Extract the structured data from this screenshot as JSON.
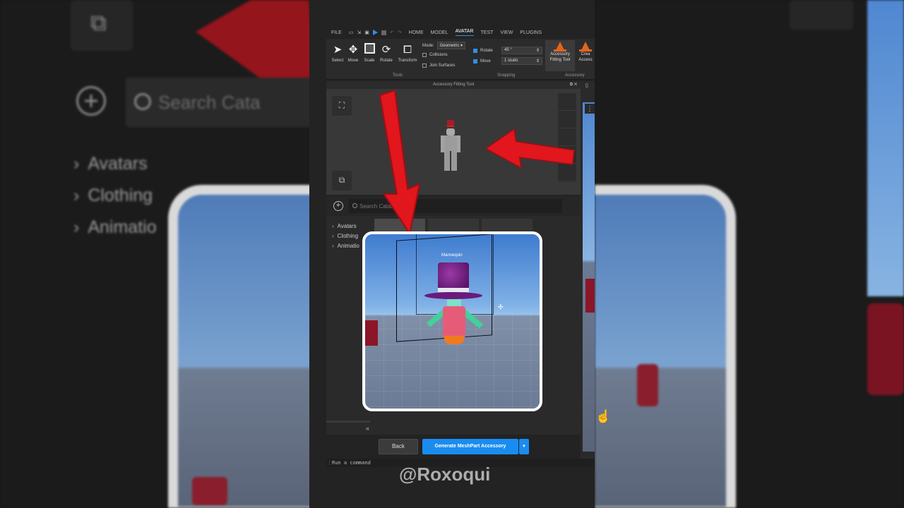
{
  "menu": {
    "file": "FILE",
    "tabs": [
      "HOME",
      "MODEL",
      "AVATAR",
      "TEST",
      "VIEW",
      "PLUGINS"
    ],
    "active_tab": "AVATAR"
  },
  "ribbon": {
    "tools": [
      "Select",
      "Move",
      "Scale",
      "Rotate",
      "Transform"
    ],
    "tools_group": "Tools",
    "mode_label": "Mode:",
    "mode_value": "Geometric",
    "collisions": "Collisions",
    "join_surfaces": "Join Surfaces",
    "rotate_label": "Rotate",
    "rotate_value": "45 °",
    "move_label": "Move",
    "move_value": "1 studs",
    "snapping_group": "Snapping",
    "accessory_fitting_tool": "Accessory Fitting Tool",
    "create_accessory_partial": "Crea Access",
    "accessory_group": "Accessory"
  },
  "panel": {
    "title": "Accessory Fitting Tool"
  },
  "catalog": {
    "search_placeholder": "Search Catalog",
    "tree": [
      "Avatars",
      "Clothing",
      "Animatio"
    ]
  },
  "preview": {
    "label": "Mannequin"
  },
  "footer": {
    "back": "Back",
    "generate": "Generate MeshPart Accessory",
    "dropdown": "▼"
  },
  "command_bar": {
    "placeholder": "Run a command"
  },
  "background": {
    "search_text": "Search Cata",
    "tree": [
      "Avatars",
      "Clothing",
      "Animatio"
    ]
  },
  "watermark": "@Roxoqui",
  "colors": {
    "accent": "#1a8cf0",
    "arrow": "#e2161d",
    "tophat": "#6a1b7c"
  }
}
